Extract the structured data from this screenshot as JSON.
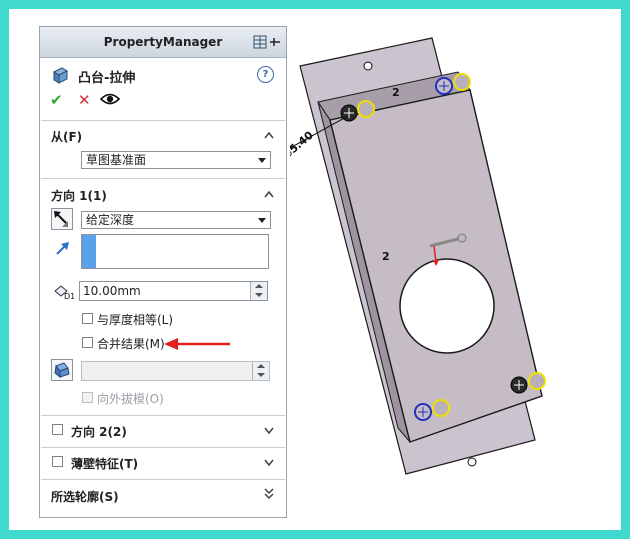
{
  "panel": {
    "title": "PropertyManager",
    "feature_title": "凸台-拉伸",
    "help_glyph": "?",
    "actions": {
      "ok": "✔",
      "cancel": "✕"
    }
  },
  "from_section": {
    "title": "从(F)",
    "start_condition": "草图基准面"
  },
  "direction1": {
    "title": "方向 1(1)",
    "end_condition": "给定深度",
    "depth": "10.00mm",
    "equal_thickness_label": "与厚度相等(L)",
    "merge_result_label": "合并结果(M)",
    "draft_outward_label": "向外拔模(O)",
    "draft_value": ""
  },
  "direction2": {
    "title": "方向 2(2)"
  },
  "thin_feature": {
    "title": "薄壁特征(T)"
  },
  "selected_contours": {
    "title": "所选轮廓(S)"
  },
  "viewport": {
    "dimension_label": "⌀5.40",
    "dim_label_top": "2",
    "dim_label_mid": "2"
  },
  "colors": {
    "border": "#40d9cf",
    "part_face": "#c6bcc6",
    "part_edge": "#1a1a1a",
    "arrow_annotation": "#e02020",
    "ok_green": "#2fa838",
    "cancel_red": "#d03030",
    "marker_yellow": "#f0e000",
    "marker_blue": "#2030c0"
  }
}
